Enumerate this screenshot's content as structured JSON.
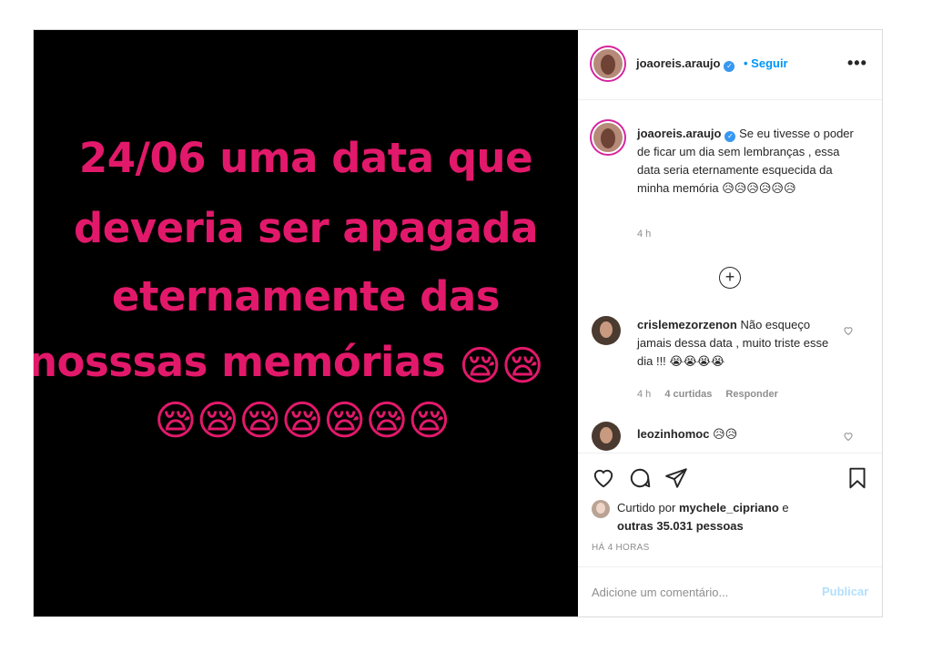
{
  "media": {
    "line1": "24/06 uma data que",
    "line2": "deveria ser apagada",
    "line3": "eternamente das",
    "line4_text": "nosssas memórias",
    "line4_emojis": "😪😪",
    "line5_emojis": "😪😪😪😪😪😪😪"
  },
  "header": {
    "username": "joaoreis.araujo",
    "verified_badge": "✓",
    "follow_label": "• Seguir",
    "more_label": "•••"
  },
  "caption": {
    "username": "joaoreis.araujo",
    "text": "Se eu tivesse o poder de ficar um dia sem lembranças , essa data seria eternamente esquecida da minha memória 😥😥😥😥😥😥",
    "time": "4 h"
  },
  "load_more_label": "+",
  "comments": [
    {
      "username": "crislemezorzenon",
      "text": "Não esqueço jamais dessa data , muito triste esse dia !!! 😭😭😭😭",
      "time": "4 h",
      "likes": "4 curtidas",
      "reply": "Responder"
    },
    {
      "username": "leozinhomoc",
      "text": "😥😥"
    }
  ],
  "likes": {
    "prefix": "Curtido por",
    "user": "mychele_cipriano",
    "and": "e",
    "others": "outras 35.031 pessoas"
  },
  "timestamp": "HÁ 4 HORAS",
  "add_comment": {
    "placeholder": "Adicione um comentário...",
    "publish_label": "Publicar"
  },
  "colors": {
    "media_text": "#e2196b",
    "link_blue": "#0095f6",
    "publish_disabled": "#b2dffc",
    "verified": "#3897f0"
  }
}
